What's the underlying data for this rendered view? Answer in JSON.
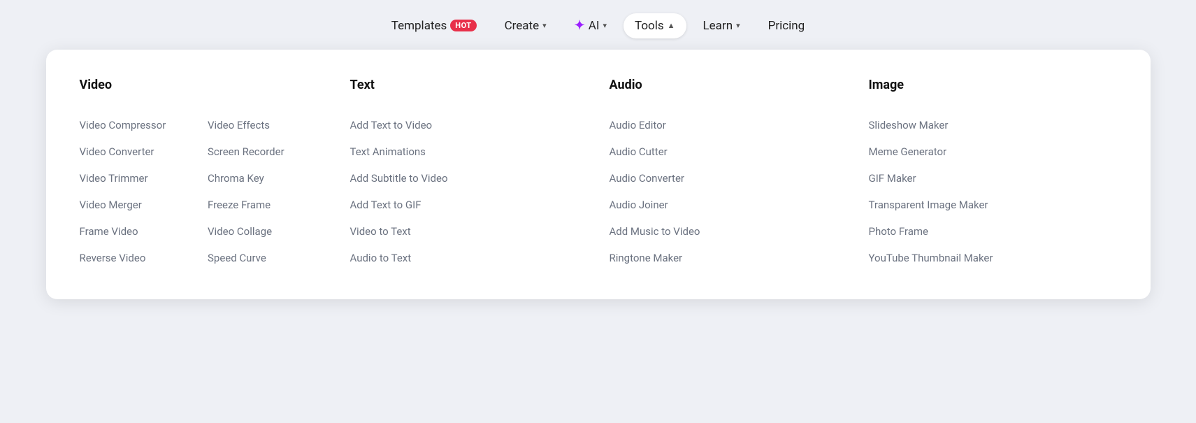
{
  "navbar": {
    "items": [
      {
        "id": "templates",
        "label": "Templates",
        "badge": "HOT",
        "active": false,
        "hasChevron": false
      },
      {
        "id": "create",
        "label": "Create",
        "active": false,
        "hasChevron": true
      },
      {
        "id": "ai",
        "label": "AI",
        "active": false,
        "hasChevron": true,
        "isAI": true
      },
      {
        "id": "tools",
        "label": "Tools",
        "active": true,
        "hasChevron": true
      },
      {
        "id": "learn",
        "label": "Learn",
        "active": false,
        "hasChevron": true
      },
      {
        "id": "pricing",
        "label": "Pricing",
        "active": false,
        "hasChevron": false
      }
    ]
  },
  "menu": {
    "sections": [
      {
        "id": "video",
        "title": "Video",
        "twoColumns": true,
        "col1": [
          "Video Compressor",
          "Video Converter",
          "Video Trimmer",
          "Video Merger",
          "Frame Video",
          "Reverse Video"
        ],
        "col2": [
          "Video Effects",
          "Screen Recorder",
          "Chroma Key",
          "Freeze Frame",
          "Video Collage",
          "Speed Curve"
        ]
      },
      {
        "id": "text",
        "title": "Text",
        "twoColumns": false,
        "col1": [
          "Add Text to Video",
          "Text Animations",
          "Add Subtitle to Video",
          "Add Text to GIF",
          "Video to Text",
          "Audio to Text"
        ]
      },
      {
        "id": "audio",
        "title": "Audio",
        "twoColumns": false,
        "col1": [
          "Audio Editor",
          "Audio Cutter",
          "Audio Converter",
          "Audio Joiner",
          "Add Music to Video",
          "Ringtone Maker"
        ]
      },
      {
        "id": "image",
        "title": "Image",
        "twoColumns": false,
        "col1": [
          "Slideshow Maker",
          "Meme Generator",
          "GIF Maker",
          "Transparent Image Maker",
          "Photo Frame",
          "YouTube Thumbnail Maker"
        ]
      }
    ]
  }
}
